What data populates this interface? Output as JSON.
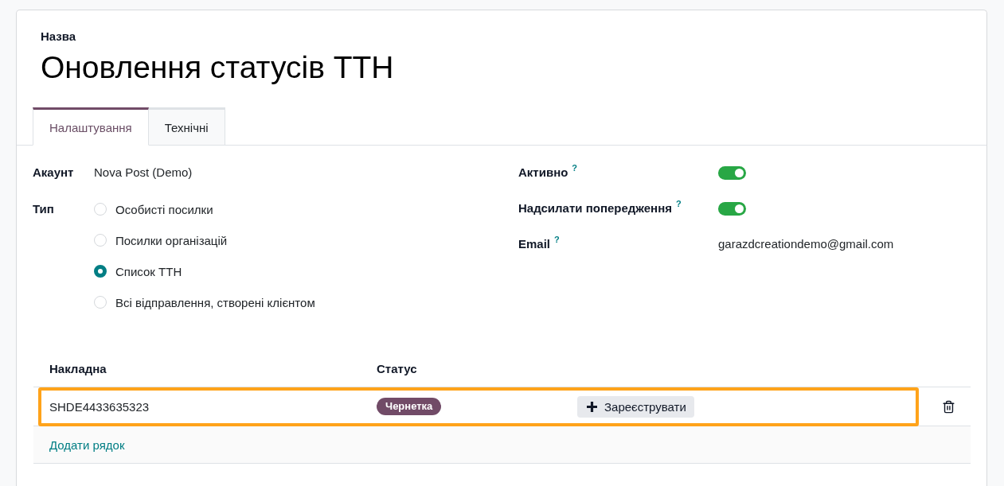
{
  "name_field": {
    "label": "Назва",
    "value": "Оновлення статусів ТТН"
  },
  "tabs": [
    {
      "label": "Налаштування",
      "selected": true
    },
    {
      "label": "Технічні",
      "selected": false
    }
  ],
  "left_fields": [
    {
      "kind": "text",
      "label": "Акаунт",
      "value": "Nova Post (Demo)"
    },
    {
      "kind": "radio",
      "label": "Тип",
      "options": [
        {
          "label": "Особисті посилки",
          "selected": false
        },
        {
          "label": "Посилки організацій",
          "selected": false
        },
        {
          "label": "Список ТТН",
          "selected": true
        },
        {
          "label": "Всі відправлення, створені клієнтом",
          "selected": false
        }
      ]
    }
  ],
  "right_fields": [
    {
      "kind": "toggle",
      "label": "Активно",
      "help": "?",
      "on": true
    },
    {
      "kind": "toggle",
      "label": "Надсилати попередження",
      "help": "?",
      "on": true
    },
    {
      "kind": "text",
      "label": "Email",
      "help": "?",
      "value": "garazdcreationdemo@gmail.com"
    }
  ],
  "table": {
    "columns": [
      "Накладна",
      "Статус"
    ],
    "rows": [
      {
        "waybill": "SHDE4433635323",
        "status": "Чернетка",
        "action": "Зареєструвати",
        "highlighted": true
      }
    ],
    "add_line": "Додати рядок"
  }
}
